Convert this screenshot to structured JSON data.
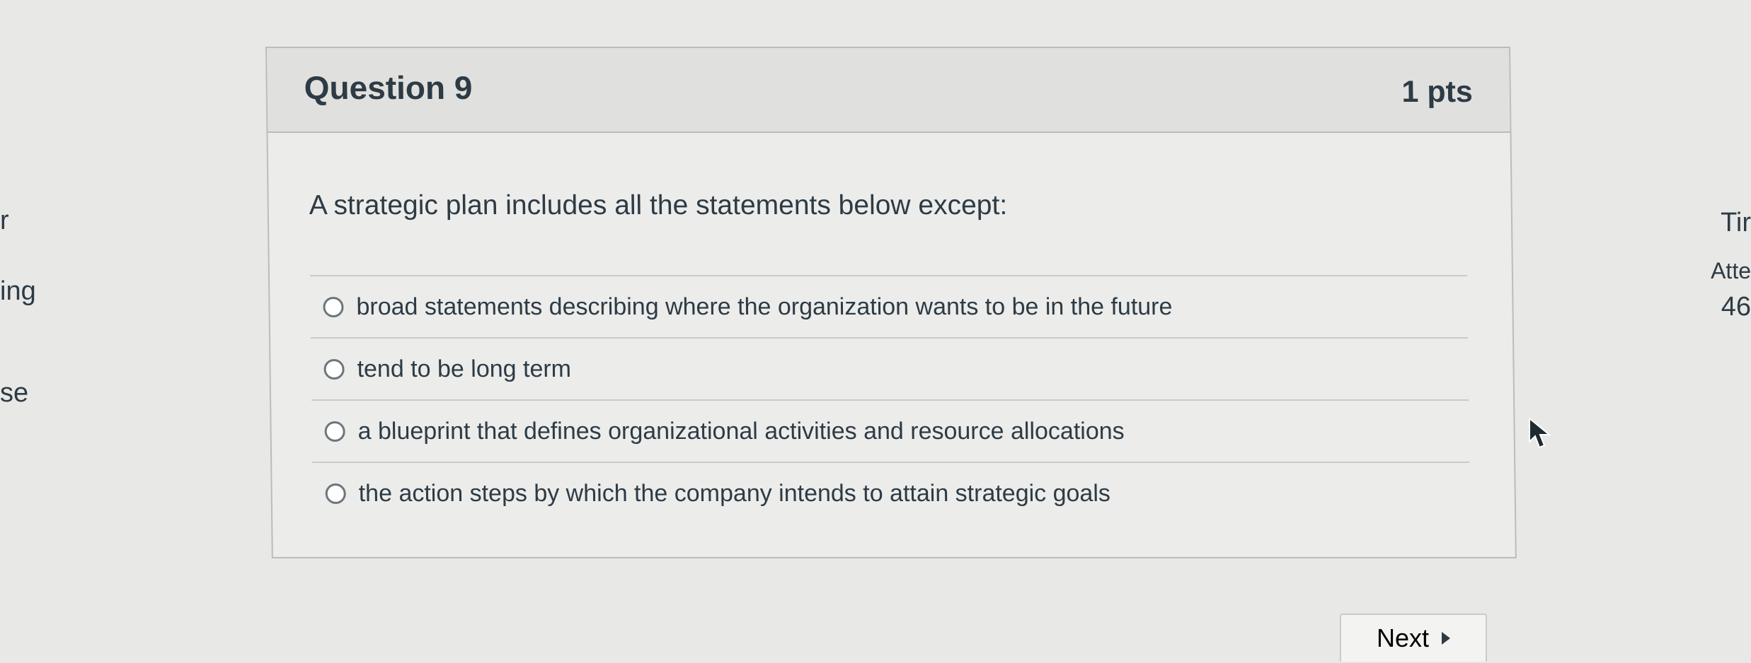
{
  "left_sidebar": {
    "fragment_1": "r",
    "fragment_2": "ing",
    "fragment_3": "se"
  },
  "question": {
    "title": "Question 9",
    "points": "1 pts",
    "prompt": "A strategic plan includes all the statements below except:",
    "answers": [
      {
        "label": "broad statements describing where the organization wants to be in the future"
      },
      {
        "label": "tend to be long term"
      },
      {
        "label": "a blueprint that defines organizational activities and resource allocations"
      },
      {
        "label": "the action steps by which the company intends to attain strategic goals"
      }
    ]
  },
  "right_panel": {
    "time_label_fragment": "Tir",
    "attempt_label_fragment": "Atte",
    "attempt_value_fragment": "46"
  },
  "navigation": {
    "next_label": "Next",
    "next_icon": "triangle-right-icon"
  },
  "cursor": {
    "icon": "mouse-pointer-icon"
  },
  "colors": {
    "text": "#2d3b45",
    "border": "#b9bdbd",
    "header_background": "#e0e0de",
    "page_background": "#e8e8e6"
  }
}
